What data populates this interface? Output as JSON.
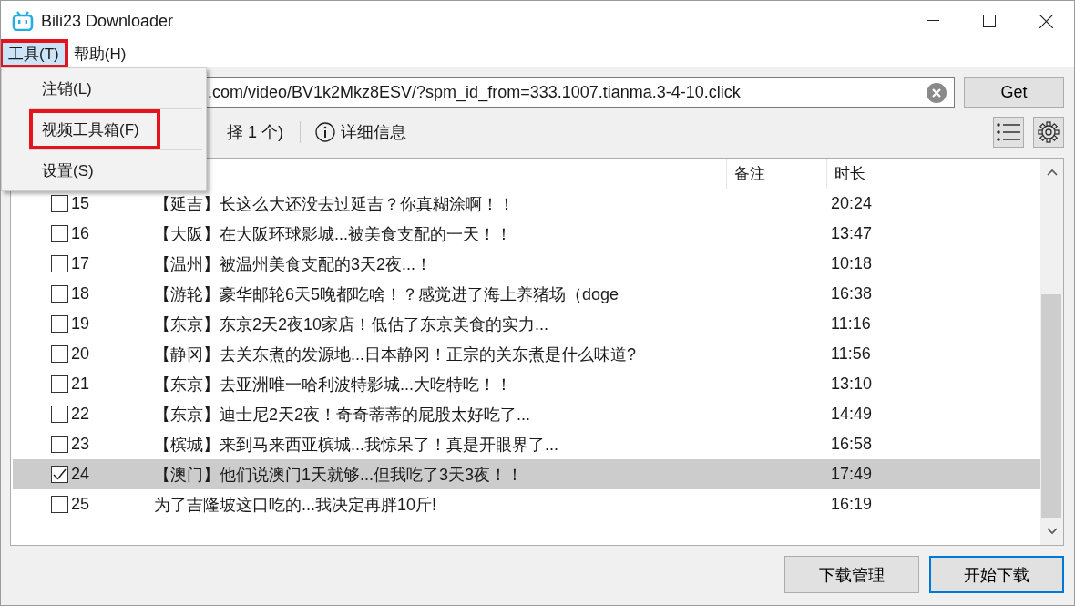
{
  "window": {
    "title": "Bili23 Downloader"
  },
  "menubar": [
    {
      "label": "工具(T)",
      "selected": true,
      "highlighted": true
    },
    {
      "label": "帮助(H)",
      "selected": false,
      "highlighted": false
    }
  ],
  "menu": {
    "items": [
      {
        "label": "注销(L)",
        "highlighted": false
      },
      {
        "label": "视频工具箱(F)",
        "highlighted": true
      },
      {
        "label": "设置(S)",
        "highlighted": false
      }
    ]
  },
  "url_field": {
    "value": ".com/video/BV1k2Mkz8ESV/?spm_id_from=333.1007.tianma.3-4-10.click"
  },
  "get_button": "Get",
  "selection_text": "择 1 个)",
  "info_button": "详细信息",
  "table": {
    "columns": [
      "备注",
      "时长"
    ],
    "rows": [
      {
        "number": "15",
        "title": "【延吉】长这么大还没去过延吉？你真糊涂啊！！",
        "duration": "20:24",
        "checked": false,
        "selected": false
      },
      {
        "number": "16",
        "title": "【大阪】在大阪环球影城...被美食支配的一天！！",
        "duration": "13:47",
        "checked": false,
        "selected": false
      },
      {
        "number": "17",
        "title": "【温州】被温州美食支配的3天2夜...！",
        "duration": "10:18",
        "checked": false,
        "selected": false
      },
      {
        "number": "18",
        "title": "【游轮】豪华邮轮6天5晚都吃啥！？感觉进了海上养猪场（doge",
        "duration": "16:38",
        "checked": false,
        "selected": false
      },
      {
        "number": "19",
        "title": "【东京】东京2天2夜10家店！低估了东京美食的实力...",
        "duration": "11:16",
        "checked": false,
        "selected": false
      },
      {
        "number": "20",
        "title": "【静冈】去关东煮的发源地...日本静冈！正宗的关东煮是什么味道?",
        "duration": "11:56",
        "checked": false,
        "selected": false
      },
      {
        "number": "21",
        "title": "【东京】去亚洲唯一哈利波特影城...大吃特吃！！",
        "duration": "13:10",
        "checked": false,
        "selected": false
      },
      {
        "number": "22",
        "title": "【东京】迪士尼2天2夜！奇奇蒂蒂的屁股太好吃了...",
        "duration": "14:49",
        "checked": false,
        "selected": false
      },
      {
        "number": "23",
        "title": "【槟城】来到马来西亚槟城...我惊呆了！真是开眼界了...",
        "duration": "16:58",
        "checked": false,
        "selected": false
      },
      {
        "number": "24",
        "title": "【澳门】他们说澳门1天就够...但我吃了3天3夜！！",
        "duration": "17:49",
        "checked": true,
        "selected": true
      },
      {
        "number": "25",
        "title": "为了吉隆坡这口吃的...我决定再胖10斤!",
        "duration": "16:19",
        "checked": false,
        "selected": false
      }
    ]
  },
  "buttons": [
    {
      "label": "下载管理",
      "default": false
    },
    {
      "label": "开始下载",
      "default": true
    }
  ]
}
